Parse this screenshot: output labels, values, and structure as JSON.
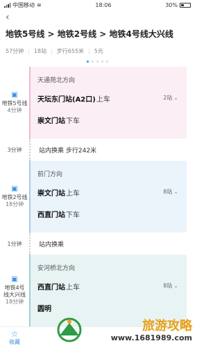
{
  "status": {
    "carrier": "中国移动",
    "time": "18:06",
    "battery": "30%"
  },
  "route_title": "地铁5号线 > 地铁2号线 > 地铁4号线大兴线",
  "summary": {
    "duration": "57分钟",
    "stops": "18站",
    "walk": "步行655米",
    "fare": "5元"
  },
  "page_dots": {
    "active": 1,
    "count": 5
  },
  "segments": [
    {
      "line": "地铁5号线",
      "duration": "4分钟",
      "direction": "天通苑北方向",
      "board": {
        "station": "天坛东门站(A2口)",
        "action": "上车",
        "stops": "2站"
      },
      "alight": {
        "station": "崇文门站",
        "action": "下车"
      }
    },
    {
      "line": "地铁2号线",
      "duration": "18分钟",
      "direction": "前门方向",
      "board": {
        "station": "崇文门站",
        "action": "上车",
        "stops": "8站"
      },
      "alight": {
        "station": "西直门站",
        "action": "下车"
      }
    },
    {
      "line": "地铁4号线大兴线",
      "duration": "18分钟",
      "direction": "安河桥北方向",
      "board": {
        "station": "西直门站",
        "action": "上车",
        "stops": "8站"
      },
      "alight": {
        "station": "圆明",
        "action": ""
      }
    }
  ],
  "transfers": [
    {
      "time": "3分钟",
      "text": "站内换乘 步行242米"
    },
    {
      "time": "1分钟",
      "text": "站内换乘"
    }
  ],
  "bottom": {
    "favorite_label": "收藏"
  },
  "watermark": {
    "title": "旅游攻略",
    "url": "www.1681989.com"
  },
  "colors": {
    "accent": "#3a8ee6",
    "line5": "#f1b8d0",
    "line2": "#a9c9ea",
    "line4": "#9fd0cf"
  }
}
